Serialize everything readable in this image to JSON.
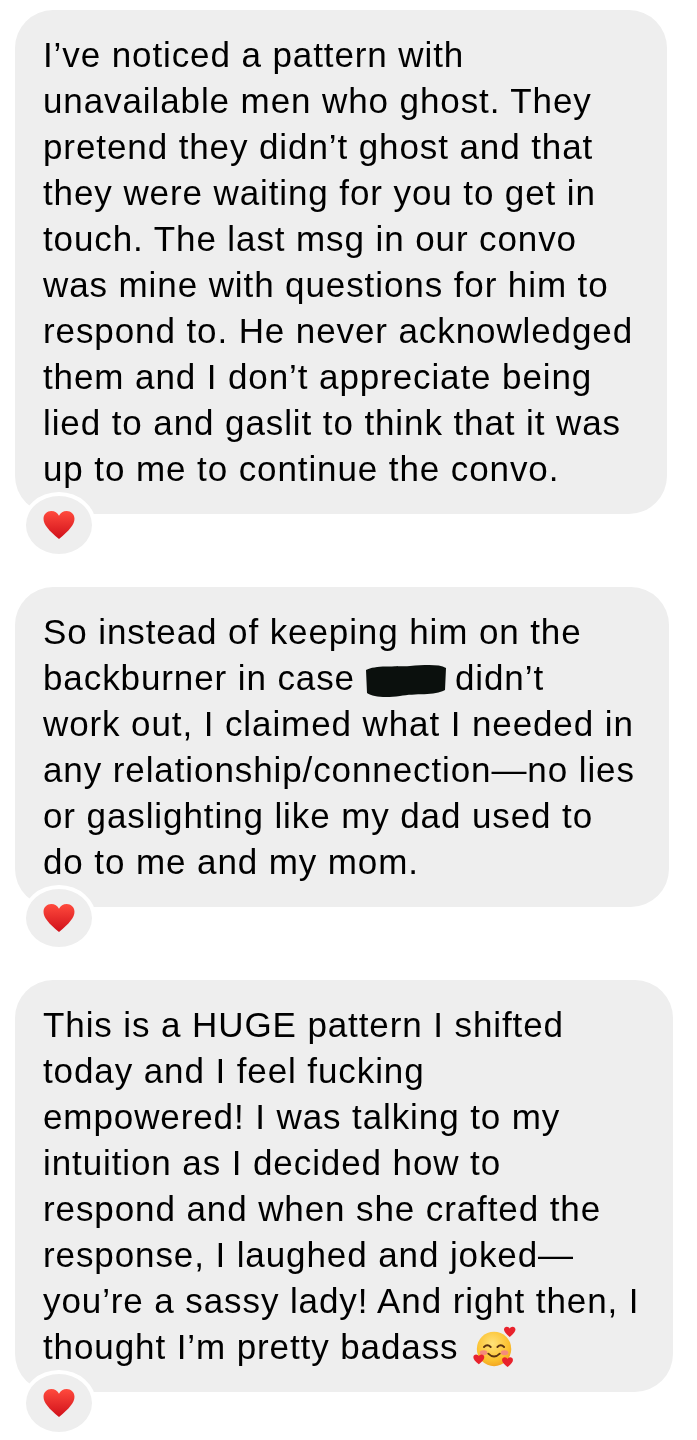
{
  "messages": [
    {
      "segments": [
        {
          "kind": "text",
          "text": "I’ve noticed a pattern with\nunavailable men who ghost. They\npretend they didn’t ghost and that\nthey were waiting for you to get in\ntouch. The last msg in our convo\nwas mine with questions for him to\nrespond to. He never acknowledged\nthem and I don’t appreciate being\nlied to and gaslit to think that it was\nup to me to continue the convo."
        }
      ],
      "reacted": true
    },
    {
      "segments": [
        {
          "kind": "text",
          "text": "So instead of keeping him on the\nbackburner in case"
        },
        {
          "kind": "redaction"
        },
        {
          "kind": "text",
          "text": "didn’t\nwork out, I claimed what I needed in\nany relationship/connection—no lies\nor gaslighting like my dad used to\ndo to me and my mom."
        }
      ],
      "reacted": true
    },
    {
      "segments": [
        {
          "kind": "text",
          "text": "This is a HUGE pattern I shifted\ntoday and I feel fucking\nempowered! I was talking to my\nintuition as I decided how to\nrespond and when she crafted the\nresponse, I laughed and joked—\nyou’re a sassy lady! And right then, I\nthought I’m pretty badass"
        },
        {
          "kind": "emoji"
        }
      ],
      "reacted": true
    }
  ]
}
